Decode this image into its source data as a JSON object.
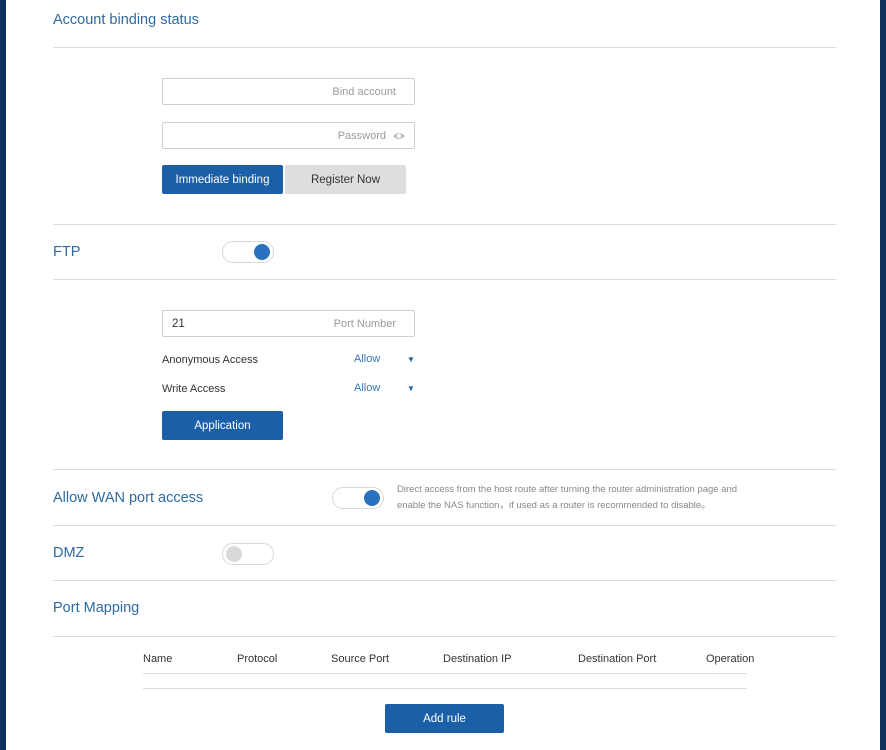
{
  "account": {
    "title": "Account binding status",
    "bind_placeholder": "Bind account",
    "password_placeholder": "Password",
    "bind_button": "Immediate binding",
    "register_button": "Register Now"
  },
  "ftp": {
    "title": "FTP",
    "enabled": true,
    "port_value": "21",
    "port_placeholder": "Port Number",
    "anonymous_label": "Anonymous Access",
    "anonymous_value": "Allow",
    "write_label": "Write Access",
    "write_value": "Allow",
    "apply_button": "Application"
  },
  "wan": {
    "title": "Allow WAN port access",
    "enabled": true,
    "note": "Direct access from the host route after turning the router administration page and enable the NAS function，if used as a router is recommended to disable。"
  },
  "dmz": {
    "title": "DMZ",
    "enabled": false
  },
  "port_mapping": {
    "title": "Port Mapping",
    "columns": [
      "Name",
      "Protocol",
      "Source Port",
      "Destination IP",
      "Destination Port",
      "Operation"
    ],
    "rows": [],
    "add_button": "Add rule"
  },
  "icons": {
    "password_toggle": "eye-icon",
    "select_caret": "caret-down-icon"
  },
  "colors": {
    "accent": "#1a5fa8",
    "title": "#2e6aa3",
    "toggle_on": "#2a72c0",
    "toggle_off": "#d9d9d9",
    "frame": "#0d2f5c"
  }
}
